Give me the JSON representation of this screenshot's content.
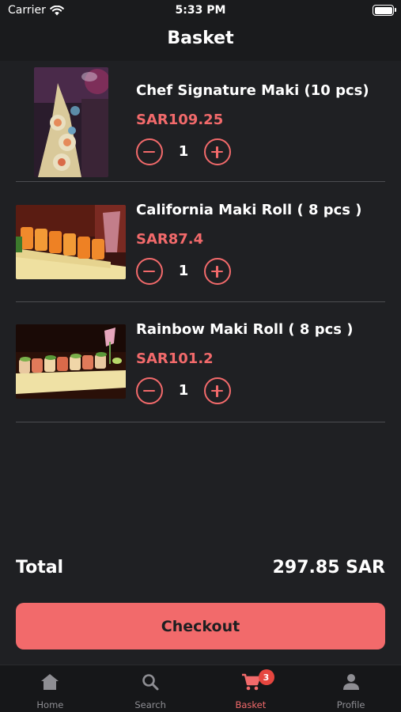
{
  "status_bar": {
    "carrier": "Carrier",
    "time": "5:33 PM"
  },
  "header": {
    "title": "Basket"
  },
  "items": [
    {
      "name": "Chef Signature Maki (10 pcs)",
      "price": "SAR109.25",
      "quantity": "1",
      "image": "maki-sushi-photo"
    },
    {
      "name": "California Maki Roll ( 8 pcs )",
      "price": "SAR87.4",
      "quantity": "1",
      "image": "california-roll-photo"
    },
    {
      "name": "Rainbow Maki Roll ( 8 pcs )",
      "price": "SAR101.2",
      "quantity": "1",
      "image": "rainbow-roll-photo"
    }
  ],
  "summary": {
    "total_label": "Total",
    "total_value": "297.85 SAR"
  },
  "checkout": {
    "label": "Checkout"
  },
  "tabbar": {
    "tabs": [
      {
        "label": "Home",
        "icon": "home-icon"
      },
      {
        "label": "Search",
        "icon": "search-icon"
      },
      {
        "label": "Basket",
        "icon": "cart-icon",
        "badge": "3",
        "active": true
      },
      {
        "label": "Profile",
        "icon": "person-icon"
      }
    ]
  },
  "colors": {
    "accent": "#f26a6b",
    "background": "#1f2023",
    "badge": "#e6463f"
  }
}
